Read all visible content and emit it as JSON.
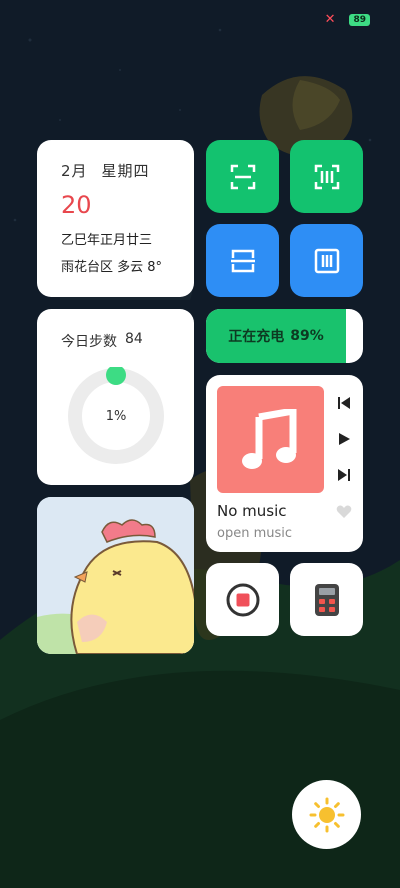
{
  "status_bar": {
    "close_glyph": "✕",
    "battery_level": "89"
  },
  "date_widget": {
    "month": "2月",
    "weekday": "星期四",
    "day": "20",
    "lunar_date": "乙巳年正月廿三",
    "weather": "雨花台区 多云 8°"
  },
  "steps_widget": {
    "label": "今日步数",
    "count": "84",
    "percent": "1%",
    "progress": 0.01
  },
  "quick_actions": [
    {
      "icon": "scan-icon",
      "color": "#13c26f"
    },
    {
      "icon": "barcode-scan-icon",
      "color": "#13c26f"
    },
    {
      "icon": "document-scan-icon",
      "color": "#2e8ef5"
    },
    {
      "icon": "payment-code-icon",
      "color": "#2e8ef5"
    }
  ],
  "battery_widget": {
    "label": "正在充电",
    "percent": "89%",
    "level": 0.89
  },
  "music_widget": {
    "title": "No music",
    "subtitle": "open music"
  },
  "shortcuts": {
    "record_icon": "record-icon",
    "calculator_icon": "calculator-icon"
  },
  "brightness": {
    "icon": "sun-icon"
  },
  "colors": {
    "accent_green": "#13c26f",
    "accent_blue": "#2e8ef5",
    "date_red": "#e8474d",
    "album_bg": "#f87f79"
  }
}
